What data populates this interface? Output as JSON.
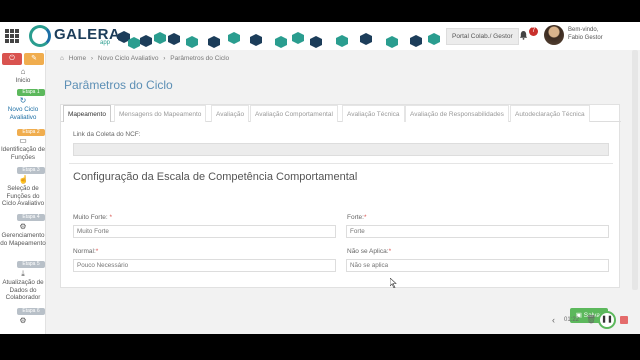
{
  "header": {
    "logo": "GALERA",
    "logo_sub": "app",
    "portal_button": "Portal Colab./ Gestor",
    "notif_count": "7",
    "welcome": "Bem-vindo,",
    "username": "Fabio Gestor"
  },
  "sidebar": {
    "items": [
      {
        "label": "Inicio",
        "icon": "home-icon"
      },
      {
        "stage": "Etapa 1",
        "label": "Novo Ciclo Avaliativo",
        "icon": "refresh-icon"
      },
      {
        "stage": "Etapa 2",
        "label": "Identificação de Funções",
        "icon": "inbox-icon"
      },
      {
        "stage": "Etapa 3",
        "label": "Seleção de Funções do Ciclo Avaliativo",
        "icon": "hand-pointer-icon"
      },
      {
        "stage": "Etapa 4",
        "label": "Gerenciamento do Mapeamento",
        "icon": "cogs-icon"
      },
      {
        "stage": "Etapa 5",
        "label": "Atualização de Dados do Colaborador",
        "icon": "download-icon"
      },
      {
        "stage": "Etapa 6",
        "label": "",
        "icon": "cogs-icon"
      }
    ]
  },
  "breadcrumb": [
    "Home",
    "Novo Ciclo Avaliativo",
    "Parâmetros do Ciclo"
  ],
  "page_title": "Parâmetros do Ciclo",
  "tabs": [
    "Mapeamento",
    "Mensagens do Mapeamento",
    "Avaliação",
    "Avaliação Comportamental",
    "Avaliação Técnica",
    "Avaliação de Responsabilidades",
    "Autodeclaração Técnica"
  ],
  "ncf": {
    "label": "Link da Coleta do NCF:",
    "value": ""
  },
  "section_title": "Configuração da Escala de Competência Comportamental",
  "fields": {
    "muito_forte": {
      "label": "Muito Forte: ",
      "placeholder": "Muito Forte"
    },
    "forte": {
      "label": "Forte:",
      "placeholder": "Forte"
    },
    "normal": {
      "label": "Normal:",
      "placeholder": "Pouco Necessário"
    },
    "nao_se_aplica": {
      "label": "Não se Aplica:",
      "placeholder": "Não se aplica"
    }
  },
  "save_label": "Salvar",
  "player": {
    "time": "01:22"
  },
  "colors": {
    "accent": "#5c8fb5",
    "success": "#5cb85c",
    "danger": "#d9534f",
    "warning": "#f0ad4e"
  }
}
